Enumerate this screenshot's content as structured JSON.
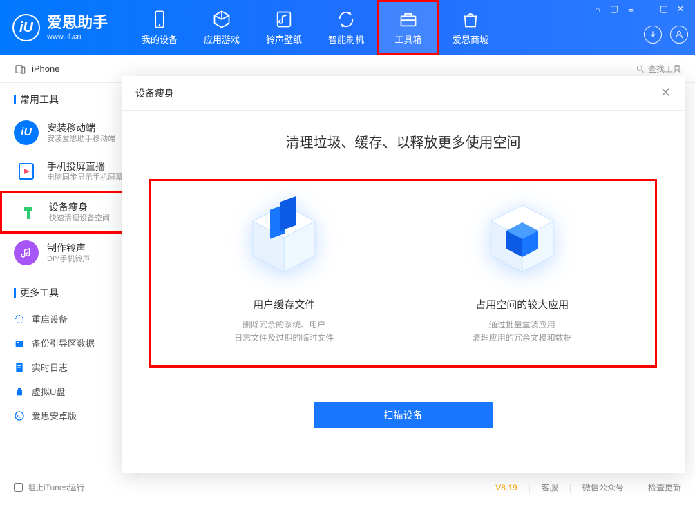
{
  "app": {
    "logo_title": "爱思助手",
    "logo_sub": "www.i4.cn",
    "logo_letter": "iU"
  },
  "nav": {
    "tabs": [
      {
        "label": "我的设备"
      },
      {
        "label": "应用游戏"
      },
      {
        "label": "铃声壁纸"
      },
      {
        "label": "智能刷机"
      },
      {
        "label": "工具箱"
      },
      {
        "label": "爱思商城"
      }
    ]
  },
  "subheader": {
    "device_name": "iPhone",
    "search_placeholder": "查找工具"
  },
  "sidebar": {
    "section1_title": "常用工具",
    "common": [
      {
        "title": "安装移动端",
        "desc": "安装爱思助手移动端"
      },
      {
        "title": "手机投屏直播",
        "desc": "电脑同步显示手机屏幕"
      },
      {
        "title": "设备瘦身",
        "desc": "快速清理设备空间"
      },
      {
        "title": "制作铃声",
        "desc": "DIY手机铃声"
      }
    ],
    "section2_title": "更多工具",
    "more": [
      {
        "label": "重启设备"
      },
      {
        "label": "备份引导区数据"
      },
      {
        "label": "实时日志"
      },
      {
        "label": "虚拟U盘"
      },
      {
        "label": "爱思安卓版"
      }
    ]
  },
  "footer": {
    "block_itunes": "阻止iTunes运行",
    "version": "V8.19",
    "support": "客服",
    "wechat": "微信公众号",
    "update": "检查更新"
  },
  "dialog": {
    "title": "设备瘦身",
    "heading": "清理垃圾、缓存、以释放更多使用空间",
    "option1": {
      "title": "用户缓存文件",
      "desc_l1": "删除冗余的系统、用户",
      "desc_l2": "日志文件及过期的临时文件"
    },
    "option2": {
      "title": "占用空间的较大应用",
      "desc_l1": "通过批量重装应用",
      "desc_l2": "清理应用的冗余文稿和数据"
    },
    "scan_button": "扫描设备"
  }
}
